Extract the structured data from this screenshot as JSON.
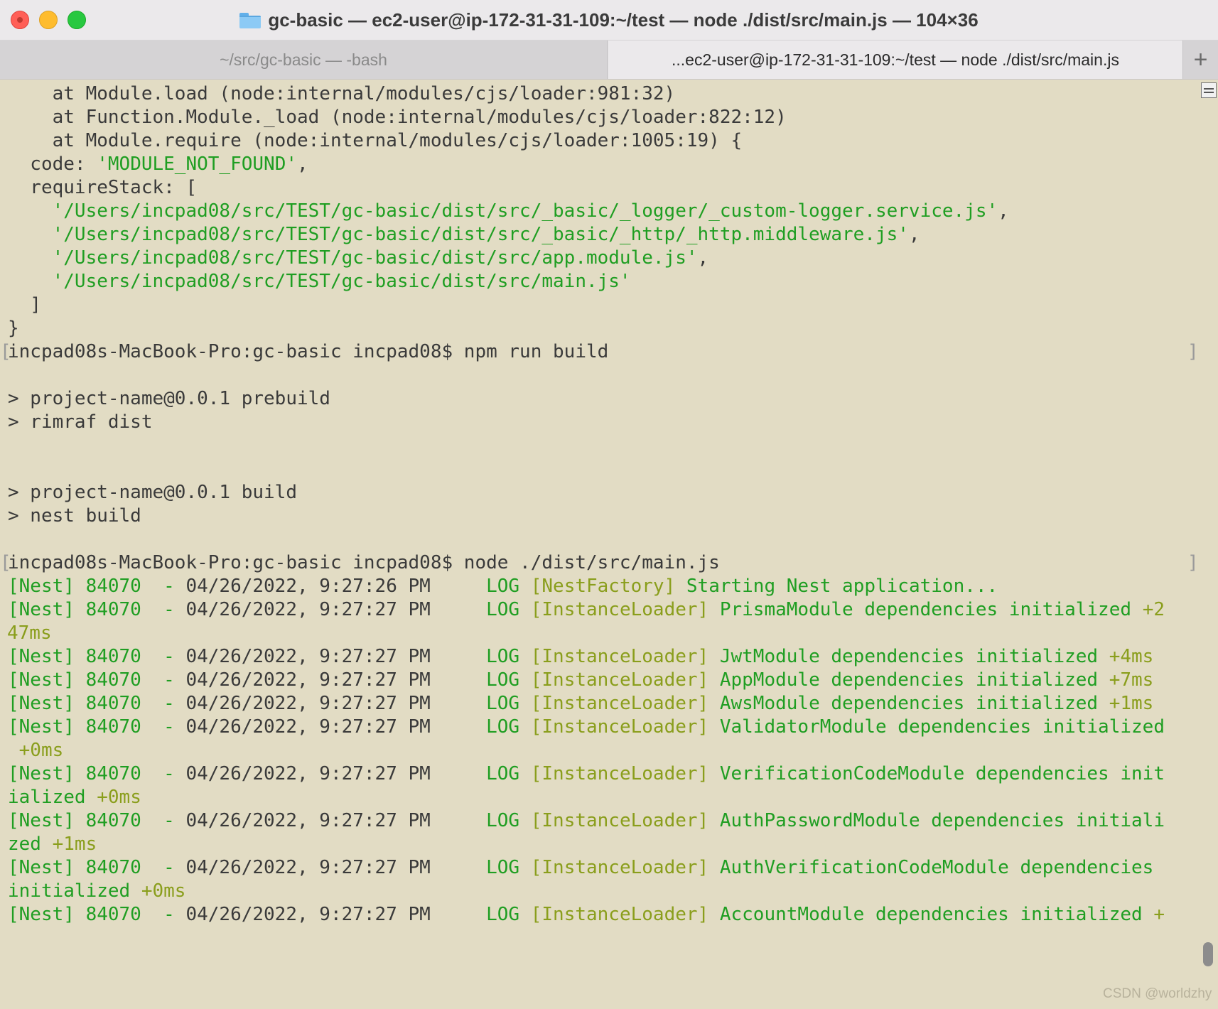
{
  "window": {
    "title": "gc-basic — ec2-user@ip-172-31-31-109:~/test — node ./dist/src/main.js — 104×36"
  },
  "tabs": [
    {
      "label": "~/src/gc-basic — -bash"
    },
    {
      "label": "...ec2-user@ip-172-31-31-109:~/test — node ./dist/src/main.js"
    }
  ],
  "new_tab_label": "+",
  "colors": {
    "background": "#e2dcc4",
    "string_green": "#1f9e22",
    "log_olive": "#8a9e1c",
    "text": "#3a3a3a"
  },
  "terminal": {
    "lines": [
      "    at Module.load (node:internal/modules/cjs/loader:981:32)",
      "    at Function.Module._load (node:internal/modules/cjs/loader:822:12)",
      "    at Module.require (node:internal/modules/cjs/loader:1005:19) {",
      "  code: ",
      "'MODULE_NOT_FOUND'",
      ",",
      "  requireStack: [",
      "    '/Users/incpad08/src/TEST/gc-basic/dist/src/_basic/_logger/_custom-logger.service.js'",
      ",",
      "    '/Users/incpad08/src/TEST/gc-basic/dist/src/_basic/_http/_http.middleware.js'",
      ",",
      "    '/Users/incpad08/src/TEST/gc-basic/dist/src/app.module.js'",
      ",",
      "    '/Users/incpad08/src/TEST/gc-basic/dist/src/main.js'",
      "  ]",
      "}",
      "incpad08s-MacBook-Pro:gc-basic incpad08$ npm run build",
      "> project-name@0.0.1 prebuild",
      "> rimraf dist",
      "> project-name@0.0.1 build",
      "> nest build",
      "incpad08s-MacBook-Pro:gc-basic incpad08$ node ./dist/src/main.js"
    ],
    "nest_prefix": "[Nest] 84070  - ",
    "log_label": "LOG",
    "log_lines": [
      {
        "ts": "04/26/2022, 9:27:26 PM",
        "ctx": "[NestFactory]",
        "msg": "Starting Nest application...",
        "dur": ""
      },
      {
        "ts": "04/26/2022, 9:27:27 PM",
        "ctx": "[InstanceLoader]",
        "msg": "PrismaModule dependencies initialized",
        "dur": "+2",
        "dur_cont": "47ms",
        "cont": ""
      },
      {
        "ts": "04/26/2022, 9:27:27 PM",
        "ctx": "[InstanceLoader]",
        "msg": "JwtModule dependencies initialized",
        "dur": "+4ms"
      },
      {
        "ts": "04/26/2022, 9:27:27 PM",
        "ctx": "[InstanceLoader]",
        "msg": "AppModule dependencies initialized",
        "dur": "+7ms"
      },
      {
        "ts": "04/26/2022, 9:27:27 PM",
        "ctx": "[InstanceLoader]",
        "msg": "AwsModule dependencies initialized",
        "dur": "+1ms"
      },
      {
        "ts": "04/26/2022, 9:27:27 PM",
        "ctx": "[InstanceLoader]",
        "msg": "ValidatorModule dependencies initialized",
        "dur": "",
        "cont": "",
        "dur_cont": " +0ms"
      },
      {
        "ts": "04/26/2022, 9:27:27 PM",
        "ctx": "[InstanceLoader]",
        "msg": "VerificationCodeModule dependencies init",
        "dur": "",
        "cont": "ialized",
        "dur_cont": " +0ms"
      },
      {
        "ts": "04/26/2022, 9:27:27 PM",
        "ctx": "[InstanceLoader]",
        "msg": "AuthPasswordModule dependencies initiali",
        "dur": "",
        "cont": "zed",
        "dur_cont": " +1ms"
      },
      {
        "ts": "04/26/2022, 9:27:27 PM",
        "ctx": "[InstanceLoader]",
        "msg": "AuthVerificationCodeModule dependencies",
        "dur": "",
        "cont": "initialized",
        "dur_cont": " +0ms"
      },
      {
        "ts": "04/26/2022, 9:27:27 PM",
        "ctx": "[InstanceLoader]",
        "msg": "AccountModule dependencies initialized",
        "dur": "+"
      }
    ],
    "prompt_bracket_left": "[",
    "prompt_bracket_right": "]"
  },
  "watermark": "CSDN @worldzhy"
}
